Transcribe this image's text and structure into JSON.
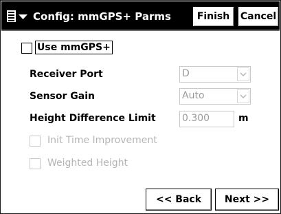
{
  "header": {
    "title": "Config: mmGPS+ Parms",
    "finish_label": "Finish",
    "cancel_label": "Cancel"
  },
  "use_mmgps": {
    "label": "Use mmGPS+",
    "checked": false
  },
  "receiver_port": {
    "label": "Receiver Port",
    "value": "D"
  },
  "sensor_gain": {
    "label": "Sensor Gain",
    "value": "Auto"
  },
  "height_difference_limit": {
    "label": "Height Difference Limit",
    "value": "0.300",
    "unit": "m"
  },
  "init_time_improvement": {
    "label": "Init Time Improvement",
    "checked": false
  },
  "weighted_height": {
    "label": "Weighted Height",
    "checked": false
  },
  "nav": {
    "back_label": "<< Back",
    "next_label": "Next >>"
  }
}
